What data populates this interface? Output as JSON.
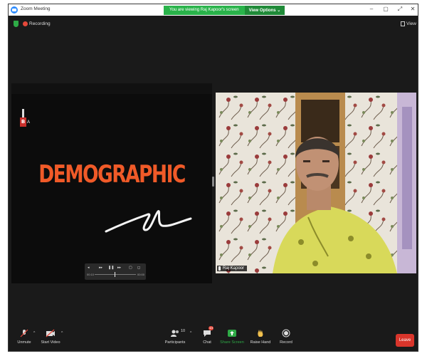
{
  "window": {
    "title": "Zoom Meeting",
    "banner_text": "You are viewing Raj Kapoor's screen",
    "view_options_label": "View Options",
    "minimize": "–",
    "restore": "▢",
    "close": "✕",
    "extra": "⤢"
  },
  "topbar": {
    "recording_label": "Recording",
    "view_label": "View"
  },
  "shared_screen": {
    "headline": "DEMOGRAPHIC",
    "logo_letter": "B",
    "logo_side": "A",
    "player": {
      "time_current": "00:10",
      "time_total": "00:00",
      "controls": [
        "◂",
        "▸▸",
        "❚❚",
        "▸▸",
        "▢",
        "◻"
      ]
    },
    "accent_color": "#f05a28"
  },
  "participant": {
    "name": "Raj Kapoor"
  },
  "toolbar": {
    "unmute_label": "Unmute",
    "start_video_label": "Start Video",
    "participants_label": "Participants",
    "participants_count": "10",
    "chat_label": "Chat",
    "chat_badge": "14",
    "share_screen_label": "Share Screen",
    "raise_hand_label": "Raise Hand",
    "record_label": "Record",
    "leave_label": "Leave",
    "caret": "^"
  },
  "colors": {
    "share_green": "#2eaa46",
    "leave_red": "#d9352b",
    "record_red": "#e5483a"
  }
}
